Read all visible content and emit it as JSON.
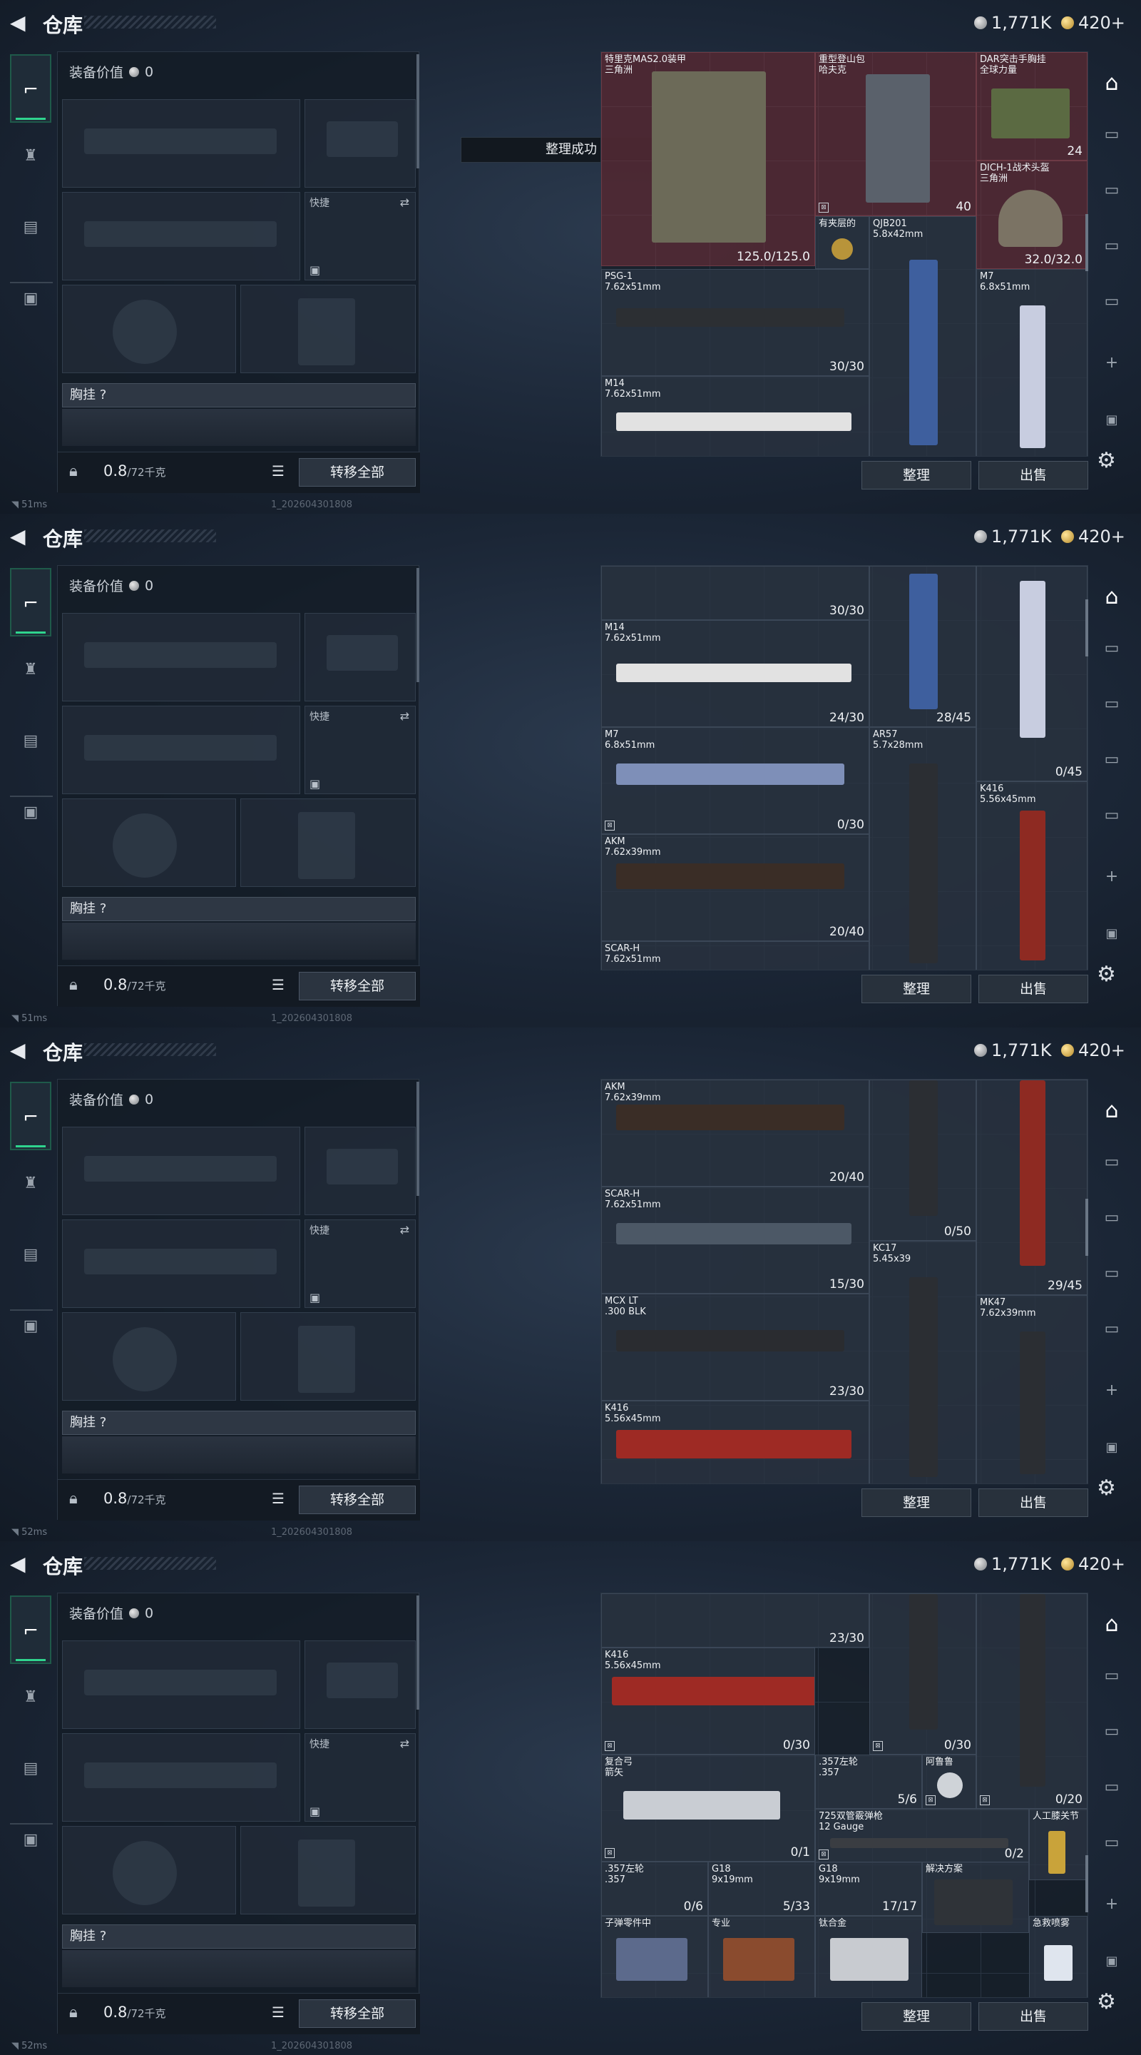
{
  "header": {
    "title": "仓库",
    "silver": "1,771K",
    "gold": "420+"
  },
  "loadout": {
    "value_label": "装备价值",
    "value": "0",
    "pistol_slot_label": "快捷",
    "chest_label": "胸挂 ?",
    "weight": "0.8",
    "weight_max": "/72千克",
    "transfer_label": "转移全部"
  },
  "network": {
    "f1": "51ms",
    "f2": "51ms",
    "f3": "52ms",
    "f4": "52ms",
    "build": "1_202604301808"
  },
  "toast": "整理成功",
  "buttons": {
    "sort": "整理",
    "sell": "出售"
  },
  "frame1": {
    "items": [
      {
        "name": "特里克MAS2.0装甲\n三角洲",
        "count": "125.0/125.0"
      },
      {
        "name": "重型登山包\n哈夫克",
        "count": "40"
      },
      {
        "name": "DAR突击手胸挂\n全球力量",
        "count": "24"
      },
      {
        "name": "DICH-1战术头盔\n三角洲",
        "count": "32.0/32.0"
      },
      {
        "name": "有夹层的",
        "count": ""
      },
      {
        "name": "QJB201\n5.8x42mm",
        "count": ""
      },
      {
        "name": "PSG-1\n7.62x51mm",
        "count": "30/30"
      },
      {
        "name": "M7\n6.8x51mm",
        "count": ""
      },
      {
        "name": "M14\n7.62x51mm",
        "count": ""
      }
    ]
  },
  "frame2": {
    "items": [
      {
        "name": "",
        "count": "30/30"
      },
      {
        "name": "M14\n7.62x51mm",
        "count": "24/30"
      },
      {
        "name": "",
        "count": "28/45"
      },
      {
        "name": "",
        "count": "0/45"
      },
      {
        "name": "M7\n6.8x51mm",
        "count": "0/30"
      },
      {
        "name": "AR57\n5.7x28mm",
        "count": ""
      },
      {
        "name": "K416\n5.56x45mm",
        "count": ""
      },
      {
        "name": "AKM\n7.62x39mm",
        "count": "20/40"
      },
      {
        "name": "SCAR-H\n7.62x51mm",
        "count": ""
      }
    ]
  },
  "frame3": {
    "items": [
      {
        "name": "AKM\n7.62x39mm",
        "count": "20/40"
      },
      {
        "name": "",
        "count": "0/50"
      },
      {
        "name": "SCAR-H\n7.62x51mm",
        "count": "15/30"
      },
      {
        "name": "",
        "count": "29/45"
      },
      {
        "name": "KC17\n5.45x39",
        "count": ""
      },
      {
        "name": "MCX LT\n.300 BLK",
        "count": "23/30"
      },
      {
        "name": "MK47\n7.62x39mm",
        "count": ""
      },
      {
        "name": "K416\n5.56x45mm",
        "count": ""
      }
    ]
  },
  "frame4": {
    "items": [
      {
        "name": "",
        "count": "23/30"
      },
      {
        "name": "K416\n5.56x45mm",
        "count": "0/30"
      },
      {
        "name": "",
        "count": "0/30"
      },
      {
        "name": "",
        "count": "0/20"
      },
      {
        "name": "复合弓\n箭矢",
        "count": "0/1"
      },
      {
        "name": ".357左轮\n.357",
        "count": "5/6"
      },
      {
        "name": "阿鲁鲁",
        "count": ""
      },
      {
        "name": "725双管霰弹枪\n12 Gauge",
        "count": "0/2"
      },
      {
        "name": "人工膝关节",
        "count": ""
      },
      {
        "name": ".357左轮\n.357",
        "count": "0/6"
      },
      {
        "name": "G18\n9x19mm",
        "count": "5/33"
      },
      {
        "name": "G18\n9x19mm",
        "count": "17/17"
      },
      {
        "name": "解决方案",
        "count": ""
      },
      {
        "name": "子弹零件中",
        "count": ""
      },
      {
        "name": "专业",
        "count": ""
      },
      {
        "name": "钛合金",
        "count": ""
      },
      {
        "name": "急救喷雾",
        "count": ""
      }
    ]
  }
}
